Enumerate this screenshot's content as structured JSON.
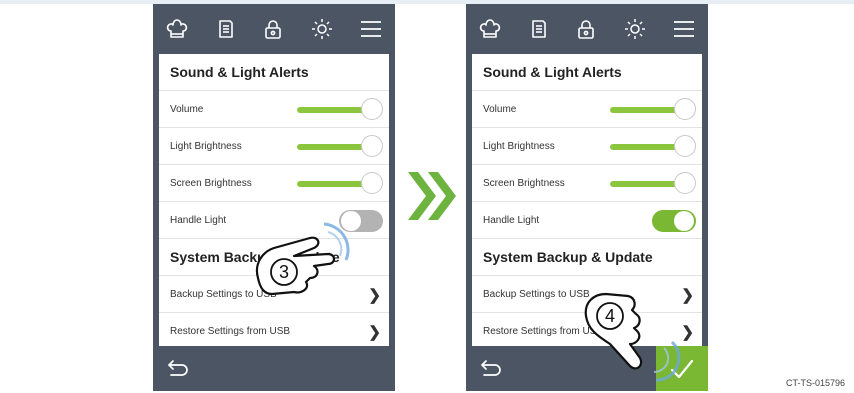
{
  "steps": [
    {
      "header_sound": "Sound & Light Alerts",
      "rows": [
        {
          "label": "Volume",
          "level_percent": 100
        },
        {
          "label": "Light Brightness",
          "level_percent": 100
        },
        {
          "label": "Screen Brightness",
          "level_percent": 100
        },
        {
          "label": "Handle Light",
          "toggle": "off"
        }
      ],
      "header_backup": "System Backup & Update",
      "backup_rows": [
        "Backup Settings to USB",
        "Restore Settings from USB"
      ],
      "step_number": "3"
    },
    {
      "header_sound": "Sound & Light Alerts",
      "rows": [
        {
          "label": "Volume",
          "level_percent": 100
        },
        {
          "label": "Light Brightness",
          "level_percent": 100
        },
        {
          "label": "Screen Brightness",
          "level_percent": 100
        },
        {
          "label": "Handle Light",
          "toggle": "on"
        }
      ],
      "header_backup": "System Backup & Update",
      "backup_rows": [
        "Backup Settings to USB",
        "Restore Settings from USB"
      ],
      "step_number": "4"
    }
  ],
  "topbar_icons": [
    "chef-hat-icon",
    "recipe-book-icon",
    "lock-icon",
    "brightness-icon",
    "menu-icon"
  ],
  "colors": {
    "bar": "#4b5563",
    "accent": "#8cc63f",
    "toggle_on": "#7ab833",
    "toggle_off": "#b3b3b3"
  },
  "caption": "CT-TS-015796"
}
